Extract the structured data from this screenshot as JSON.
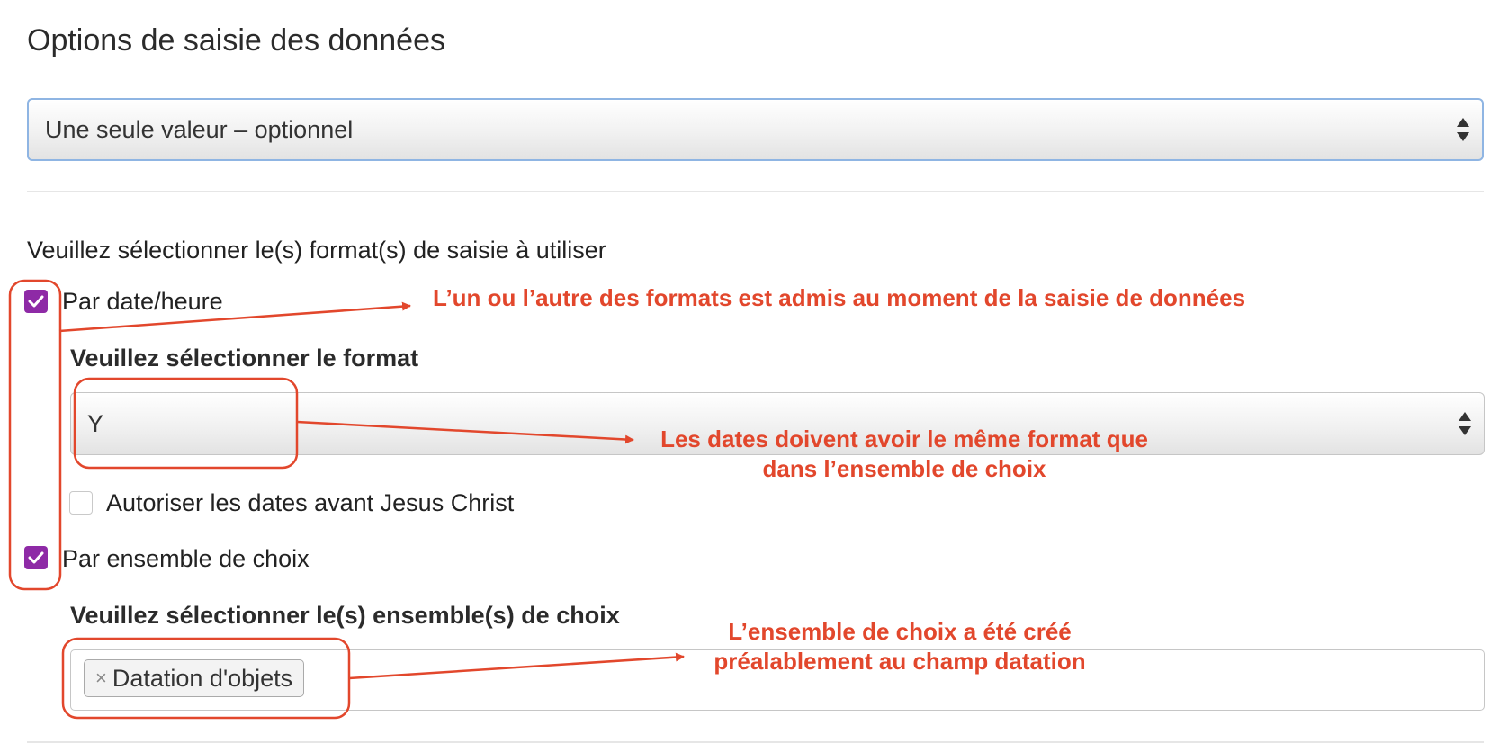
{
  "section_title": "Options de saisie des données",
  "entry_mode_select": {
    "value": "Une seule valeur – optionnel"
  },
  "formats": {
    "prompt": "Veuillez sélectionner le(s) format(s) de saisie à utiliser",
    "by_datetime": {
      "label": "Par date/heure",
      "checked": true
    },
    "format_prompt": "Veuillez sélectionner le format",
    "format_select": {
      "value": "Y"
    },
    "allow_bc": {
      "label": "Autoriser les dates avant Jesus Christ",
      "checked": false
    },
    "by_choice_set": {
      "label": "Par ensemble de choix",
      "checked": true
    },
    "choice_set_prompt": "Veuillez sélectionner le(s) ensemble(s) de choix",
    "selected_tags": [
      {
        "label": "Datation d'objets",
        "remove_glyph": "×"
      }
    ]
  },
  "annotations": {
    "note1": "L’un ou l’autre des formats est admis au moment de la saisie de données",
    "note2_line1": "Les dates doivent avoir le même format que",
    "note2_line2": "dans l’ensemble de choix",
    "note3_line1": "L’ensemble de choix a été créé",
    "note3_line2": "préalablement au champ datation"
  },
  "colors": {
    "accent": "#8e2aa6",
    "annotation": "#e2472c",
    "focus_border": "#8fb5e3"
  }
}
